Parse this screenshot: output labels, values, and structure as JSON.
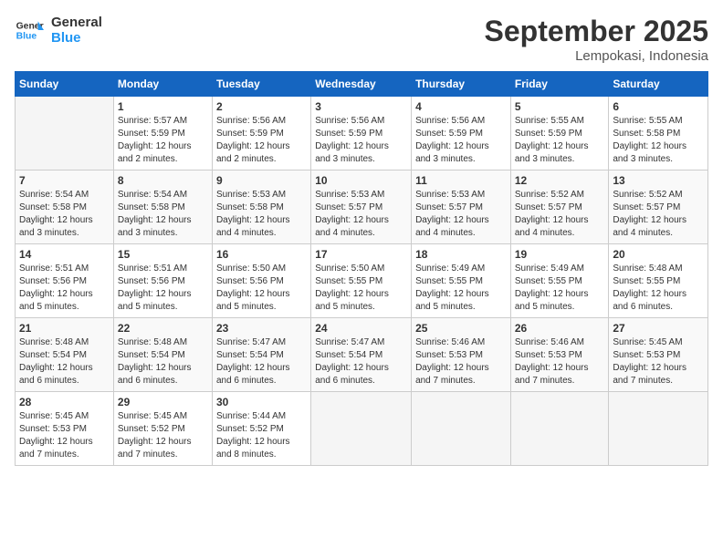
{
  "header": {
    "logo_line1": "General",
    "logo_line2": "Blue",
    "month": "September 2025",
    "location": "Lempokasi, Indonesia"
  },
  "days_of_week": [
    "Sunday",
    "Monday",
    "Tuesday",
    "Wednesday",
    "Thursday",
    "Friday",
    "Saturday"
  ],
  "weeks": [
    [
      {
        "day": "",
        "info": ""
      },
      {
        "day": "1",
        "info": "Sunrise: 5:57 AM\nSunset: 5:59 PM\nDaylight: 12 hours\nand 2 minutes."
      },
      {
        "day": "2",
        "info": "Sunrise: 5:56 AM\nSunset: 5:59 PM\nDaylight: 12 hours\nand 2 minutes."
      },
      {
        "day": "3",
        "info": "Sunrise: 5:56 AM\nSunset: 5:59 PM\nDaylight: 12 hours\nand 3 minutes."
      },
      {
        "day": "4",
        "info": "Sunrise: 5:56 AM\nSunset: 5:59 PM\nDaylight: 12 hours\nand 3 minutes."
      },
      {
        "day": "5",
        "info": "Sunrise: 5:55 AM\nSunset: 5:59 PM\nDaylight: 12 hours\nand 3 minutes."
      },
      {
        "day": "6",
        "info": "Sunrise: 5:55 AM\nSunset: 5:58 PM\nDaylight: 12 hours\nand 3 minutes."
      }
    ],
    [
      {
        "day": "7",
        "info": "Sunrise: 5:54 AM\nSunset: 5:58 PM\nDaylight: 12 hours\nand 3 minutes."
      },
      {
        "day": "8",
        "info": "Sunrise: 5:54 AM\nSunset: 5:58 PM\nDaylight: 12 hours\nand 3 minutes."
      },
      {
        "day": "9",
        "info": "Sunrise: 5:53 AM\nSunset: 5:58 PM\nDaylight: 12 hours\nand 4 minutes."
      },
      {
        "day": "10",
        "info": "Sunrise: 5:53 AM\nSunset: 5:57 PM\nDaylight: 12 hours\nand 4 minutes."
      },
      {
        "day": "11",
        "info": "Sunrise: 5:53 AM\nSunset: 5:57 PM\nDaylight: 12 hours\nand 4 minutes."
      },
      {
        "day": "12",
        "info": "Sunrise: 5:52 AM\nSunset: 5:57 PM\nDaylight: 12 hours\nand 4 minutes."
      },
      {
        "day": "13",
        "info": "Sunrise: 5:52 AM\nSunset: 5:57 PM\nDaylight: 12 hours\nand 4 minutes."
      }
    ],
    [
      {
        "day": "14",
        "info": "Sunrise: 5:51 AM\nSunset: 5:56 PM\nDaylight: 12 hours\nand 5 minutes."
      },
      {
        "day": "15",
        "info": "Sunrise: 5:51 AM\nSunset: 5:56 PM\nDaylight: 12 hours\nand 5 minutes."
      },
      {
        "day": "16",
        "info": "Sunrise: 5:50 AM\nSunset: 5:56 PM\nDaylight: 12 hours\nand 5 minutes."
      },
      {
        "day": "17",
        "info": "Sunrise: 5:50 AM\nSunset: 5:55 PM\nDaylight: 12 hours\nand 5 minutes."
      },
      {
        "day": "18",
        "info": "Sunrise: 5:49 AM\nSunset: 5:55 PM\nDaylight: 12 hours\nand 5 minutes."
      },
      {
        "day": "19",
        "info": "Sunrise: 5:49 AM\nSunset: 5:55 PM\nDaylight: 12 hours\nand 5 minutes."
      },
      {
        "day": "20",
        "info": "Sunrise: 5:48 AM\nSunset: 5:55 PM\nDaylight: 12 hours\nand 6 minutes."
      }
    ],
    [
      {
        "day": "21",
        "info": "Sunrise: 5:48 AM\nSunset: 5:54 PM\nDaylight: 12 hours\nand 6 minutes."
      },
      {
        "day": "22",
        "info": "Sunrise: 5:48 AM\nSunset: 5:54 PM\nDaylight: 12 hours\nand 6 minutes."
      },
      {
        "day": "23",
        "info": "Sunrise: 5:47 AM\nSunset: 5:54 PM\nDaylight: 12 hours\nand 6 minutes."
      },
      {
        "day": "24",
        "info": "Sunrise: 5:47 AM\nSunset: 5:54 PM\nDaylight: 12 hours\nand 6 minutes."
      },
      {
        "day": "25",
        "info": "Sunrise: 5:46 AM\nSunset: 5:53 PM\nDaylight: 12 hours\nand 7 minutes."
      },
      {
        "day": "26",
        "info": "Sunrise: 5:46 AM\nSunset: 5:53 PM\nDaylight: 12 hours\nand 7 minutes."
      },
      {
        "day": "27",
        "info": "Sunrise: 5:45 AM\nSunset: 5:53 PM\nDaylight: 12 hours\nand 7 minutes."
      }
    ],
    [
      {
        "day": "28",
        "info": "Sunrise: 5:45 AM\nSunset: 5:53 PM\nDaylight: 12 hours\nand 7 minutes."
      },
      {
        "day": "29",
        "info": "Sunrise: 5:45 AM\nSunset: 5:52 PM\nDaylight: 12 hours\nand 7 minutes."
      },
      {
        "day": "30",
        "info": "Sunrise: 5:44 AM\nSunset: 5:52 PM\nDaylight: 12 hours\nand 8 minutes."
      },
      {
        "day": "",
        "info": ""
      },
      {
        "day": "",
        "info": ""
      },
      {
        "day": "",
        "info": ""
      },
      {
        "day": "",
        "info": ""
      }
    ]
  ]
}
